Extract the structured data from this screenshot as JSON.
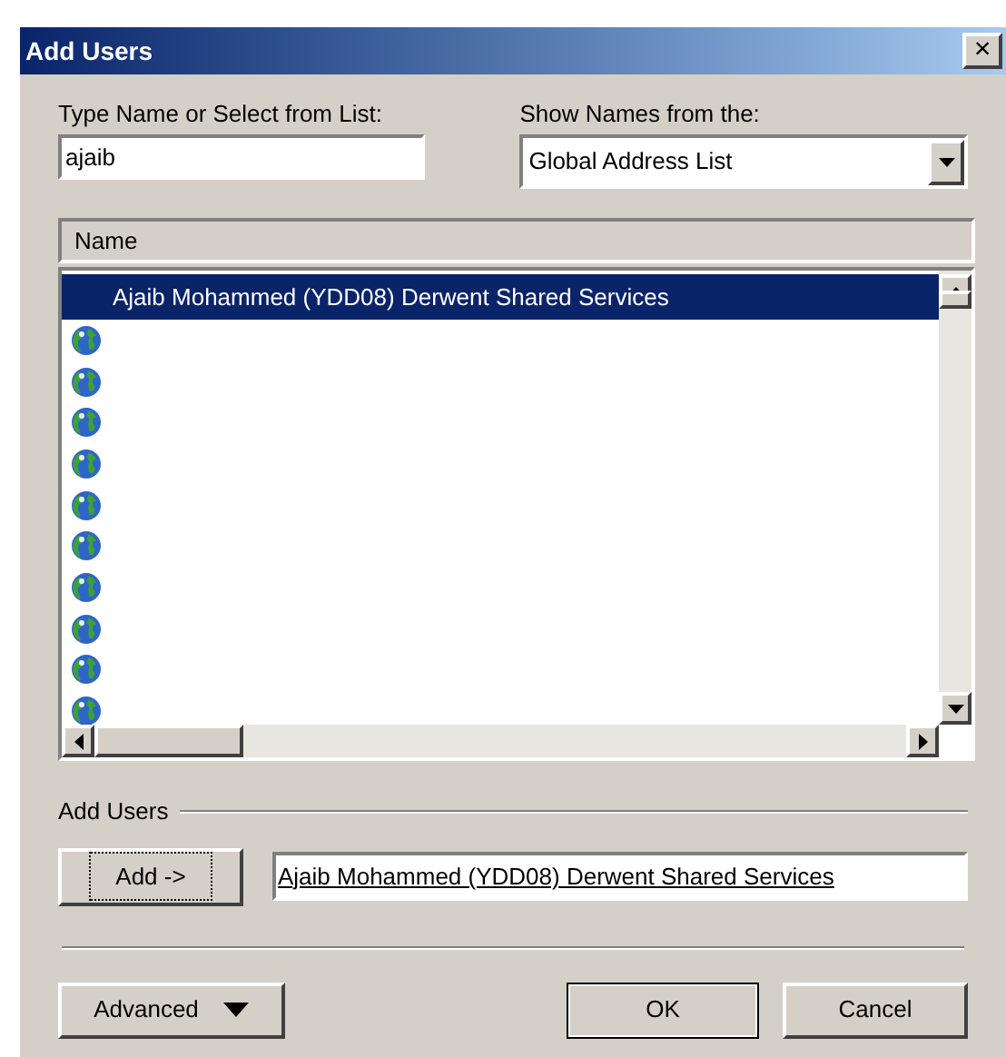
{
  "window": {
    "title": "Add Users",
    "close": "×"
  },
  "search": {
    "label": "Type Name or Select from List:",
    "value": "ajaib"
  },
  "source": {
    "label": "Show Names from the:",
    "value": "Global Address List"
  },
  "list": {
    "columns": [
      "Name"
    ],
    "rows": [
      {
        "name": "Ajaib Mohammed (YDD08) Derwent Shared Services",
        "selected": true
      },
      {
        "selected": false
      },
      {
        "selected": false
      },
      {
        "selected": false
      },
      {
        "selected": false
      },
      {
        "selected": false
      },
      {
        "selected": false
      },
      {
        "selected": false
      },
      {
        "selected": false
      },
      {
        "selected": false
      },
      {
        "selected": false
      }
    ]
  },
  "add_users": {
    "label": "Add Users",
    "button": "Add ->",
    "value": "Ajaib Mohammed (YDD08) Derwent Shared Services",
    "resolved": true
  },
  "buttons": [
    {
      "label": "Advanced",
      "kind": "menu"
    },
    {
      "label": "OK",
      "kind": "default"
    },
    {
      "label": "Cancel",
      "kind": "plain"
    }
  ]
}
